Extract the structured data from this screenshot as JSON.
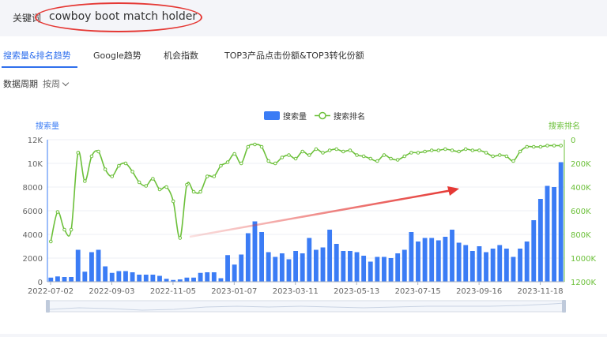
{
  "keyword": {
    "label": "关键词",
    "value": "cowboy boot match holder"
  },
  "tabs": [
    {
      "label": "搜索量&排名趋势",
      "active": true
    },
    {
      "label": "Google趋势",
      "active": false
    },
    {
      "label": "机会指数",
      "active": false
    },
    {
      "label": "TOP3产品点击份额&TOP3转化份额",
      "active": false
    }
  ],
  "period": {
    "label": "数据周期",
    "value": "按周"
  },
  "colors": {
    "bar": "#3b7cf5",
    "line": "#6cc03a",
    "annotation": "#e53935",
    "accent": "#2f6fed"
  },
  "chart_data": {
    "type": "bar+line",
    "legend": [
      "搜索量",
      "搜索排名"
    ],
    "legend_position": "top-center",
    "y_left": {
      "label": "搜索量",
      "range": [
        0,
        12000
      ],
      "ticks": [
        "0",
        "2000",
        "4000",
        "6000",
        "8000",
        "10K",
        "12K"
      ]
    },
    "y_right": {
      "label": "搜索排名",
      "range": [
        0,
        1200000
      ],
      "inverted": true,
      "ticks": [
        "0",
        "200K",
        "400K",
        "600K",
        "800K",
        "1000K",
        "1200K"
      ]
    },
    "x_ticks": [
      "2022-07-02",
      "2022-09-03",
      "2022-11-05",
      "2023-01-07",
      "2023-03-11",
      "2023-05-13",
      "2023-07-15",
      "2023-09-16",
      "2023-11-18"
    ],
    "series": [
      {
        "name": "搜索量",
        "type": "bar",
        "values": [
          350,
          450,
          400,
          400,
          2700,
          850,
          2500,
          2700,
          1300,
          750,
          900,
          900,
          800,
          600,
          600,
          600,
          500,
          250,
          150,
          200,
          350,
          350,
          750,
          800,
          800,
          300,
          2250,
          1450,
          2300,
          4100,
          5100,
          4200,
          2500,
          2100,
          2400,
          1900,
          2600,
          2400,
          3700,
          2700,
          2900,
          4400,
          3200,
          2600,
          2600,
          2500,
          2200,
          1700,
          2100,
          2100,
          2000,
          2400,
          2700,
          4200,
          3400,
          3700,
          3700,
          3500,
          3800,
          4400,
          3300,
          3100,
          2600,
          3000,
          2500,
          2800,
          3100,
          2800,
          2100,
          2800,
          3400,
          5200,
          7000,
          8100,
          8000,
          10100
        ]
      },
      {
        "name": "搜索排名",
        "type": "line",
        "values": [
          860000,
          610000,
          760000,
          760000,
          110000,
          350000,
          140000,
          100000,
          250000,
          310000,
          220000,
          200000,
          270000,
          360000,
          390000,
          330000,
          420000,
          400000,
          520000,
          830000,
          380000,
          440000,
          440000,
          310000,
          310000,
          220000,
          190000,
          120000,
          200000,
          60000,
          40000,
          60000,
          180000,
          200000,
          150000,
          130000,
          160000,
          100000,
          130000,
          80000,
          110000,
          90000,
          80000,
          100000,
          90000,
          130000,
          140000,
          160000,
          180000,
          130000,
          160000,
          170000,
          140000,
          110000,
          110000,
          100000,
          90000,
          90000,
          80000,
          90000,
          100000,
          80000,
          90000,
          90000,
          110000,
          140000,
          130000,
          140000,
          180000,
          100000,
          60000,
          60000,
          60000,
          50000,
          50000,
          50000
        ]
      }
    ]
  }
}
